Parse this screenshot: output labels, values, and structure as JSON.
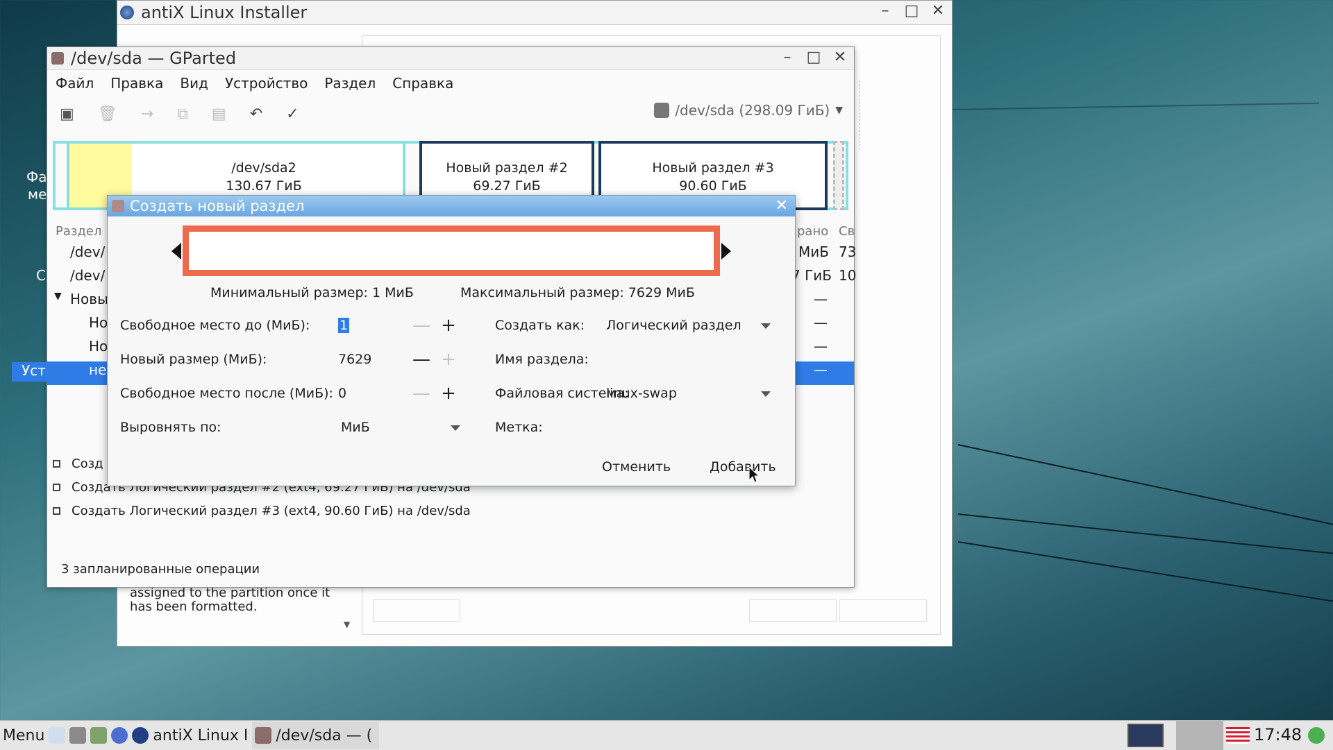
{
  "desktop": {
    "labels": [
      "Фа",
      "ме",
      "С"
    ]
  },
  "installer": {
    "title": "antiX Linux Installer",
    "help_text": [
      "assigned to the partition once it",
      "has been formatted."
    ]
  },
  "gparted": {
    "title": "/dev/sda — GParted",
    "menu": [
      "Файл",
      "Правка",
      "Вид",
      "Устройство",
      "Раздел",
      "Справка"
    ],
    "device": "/dev/sda (298.09 ГиБ)",
    "partitions": [
      {
        "name": "/dev/sda2",
        "size": "130.67 ГиБ"
      },
      {
        "name": "Новый раздел #2",
        "size": "69.27 ГиБ"
      },
      {
        "name": "Новый раздел #3",
        "size": "90.60 ГиБ"
      }
    ],
    "list_header": "Раздел",
    "list_rows": [
      "/dev/",
      "/dev/",
      "Новы",
      "Но",
      "Но",
      "не"
    ],
    "right_columns": {
      "header1": "рано",
      "header2": "Св",
      "r1c1": "МиБ",
      "r1c2": "73",
      "r2c1": "7 ГиБ",
      "r2c2": "10",
      "dash": "—"
    },
    "operations": [
      "Созд",
      "Создать Логический раздел #2 (ext4, 69.27 ГиБ) на /dev/sda",
      "Создать Логический раздел #3 (ext4, 90.60 ГиБ) на /dev/sda"
    ],
    "status": "3 запланированные операции"
  },
  "dialog": {
    "title": "Создать новый раздел",
    "min_size": "Минимальный размер: 1 МиБ",
    "max_size": "Максимальный размер: 7629 МиБ",
    "free_before_label": "Свободное место до (МиБ):",
    "free_before_value": "1",
    "new_size_label": "Новый размер (МиБ):",
    "new_size_value": "7629",
    "free_after_label": "Свободное место после (МиБ):",
    "free_after_value": "0",
    "align_label": "Выровнять по:",
    "align_value": "МиБ",
    "create_as_label": "Создать как:",
    "create_as_value": "Логический раздел",
    "part_name_label": "Имя раздела:",
    "fs_label": "Файловая система:",
    "fs_value": "linux-swap",
    "label_label": "Метка:",
    "cancel": "Отменить",
    "add": "Добавить"
  },
  "taskbar": {
    "menu": "Menu",
    "task1": "antiX Linux I",
    "task2": "/dev/sda — (",
    "clock": "17:48"
  }
}
